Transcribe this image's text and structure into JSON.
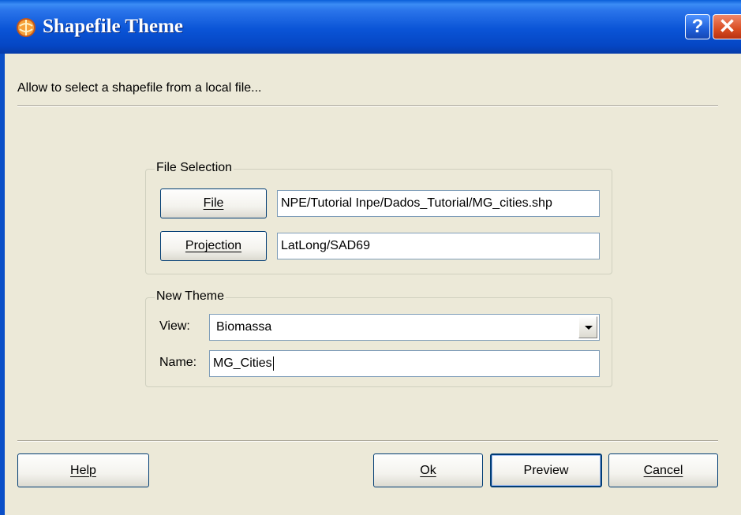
{
  "window": {
    "title": "Shapefile Theme",
    "icon": "theme-app-icon",
    "help_icon": "question-mark-icon",
    "close_icon": "close-x-icon"
  },
  "titlebar": {
    "help_glyph": "?",
    "close_glyph": "✕"
  },
  "description": "Allow to select a shapefile from a local file...",
  "file_selection": {
    "legend": "File Selection",
    "file_button": {
      "label": "File",
      "mnemonic_index": 0
    },
    "file_path": "NPE/Tutorial Inpe/Dados_Tutorial/MG_cities.shp",
    "projection_button": {
      "label": "Projection",
      "mnemonic_index": 0
    },
    "projection_value": "LatLong/SAD69"
  },
  "new_theme": {
    "legend": "New Theme",
    "view_label": "View:",
    "view_value": "Biomassa",
    "name_label": "Name:",
    "name_value": "MG_Cities"
  },
  "buttons": {
    "help": "Help",
    "ok": "Ok",
    "preview": "Preview",
    "cancel": "Cancel"
  }
}
